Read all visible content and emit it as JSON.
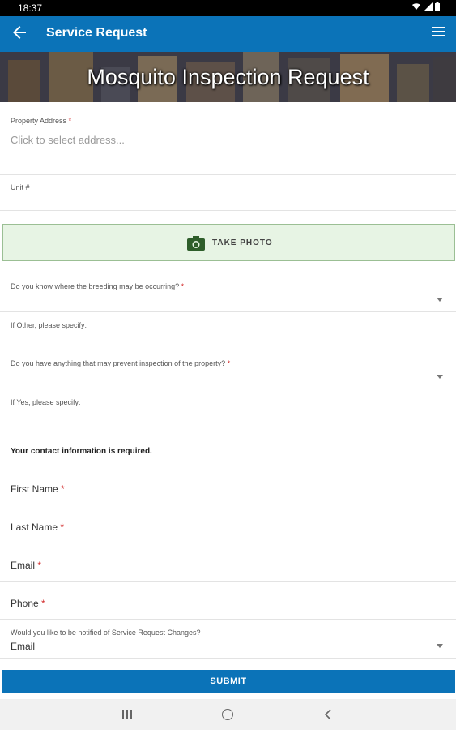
{
  "status_bar": {
    "time": "18:37"
  },
  "app_bar": {
    "title": "Service Request"
  },
  "hero": {
    "title": "Mosquito Inspection Request"
  },
  "form": {
    "property_address": {
      "label": "Property Address",
      "required": "*",
      "placeholder": "Click to select address..."
    },
    "unit": {
      "label": "Unit #"
    },
    "take_photo": {
      "label": "TAKE PHOTO"
    },
    "breeding": {
      "label": "Do you know where the breeding may be occurring?",
      "required": "*"
    },
    "breeding_other": {
      "label": "If Other, please specify:"
    },
    "prevent_inspection": {
      "label": "Do you have anything that may prevent inspection of the property?",
      "required": "*"
    },
    "prevent_yes": {
      "label": "If Yes, please specify:"
    },
    "contact_heading": "Your contact information is required.",
    "first_name": {
      "label": "First Name",
      "required": "*"
    },
    "last_name": {
      "label": "Last Name",
      "required": "*"
    },
    "email": {
      "label": "Email",
      "required": "*"
    },
    "phone": {
      "label": "Phone",
      "required": "*"
    },
    "notify": {
      "label": "Would you like to be notified of Service Request Changes?",
      "value": "Email"
    },
    "submit": {
      "label": "SUBMIT"
    }
  },
  "colors": {
    "primary": "#0b73b8",
    "photo_bg": "#e7f4e4",
    "required": "#d32f2f"
  },
  "icons": [
    "back-arrow-icon",
    "hamburger-menu-icon",
    "camera-icon",
    "chevron-down-icon",
    "recent-apps-icon",
    "home-icon",
    "back-icon"
  ]
}
